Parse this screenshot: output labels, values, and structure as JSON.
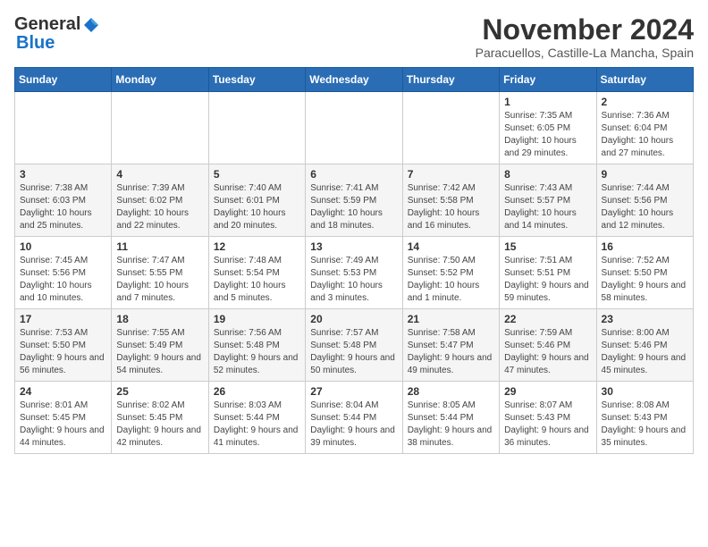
{
  "logo": {
    "general": "General",
    "blue": "Blue"
  },
  "title": "November 2024",
  "location": "Paracuellos, Castille-La Mancha, Spain",
  "headers": [
    "Sunday",
    "Monday",
    "Tuesday",
    "Wednesday",
    "Thursday",
    "Friday",
    "Saturday"
  ],
  "weeks": [
    [
      {
        "day": "",
        "info": ""
      },
      {
        "day": "",
        "info": ""
      },
      {
        "day": "",
        "info": ""
      },
      {
        "day": "",
        "info": ""
      },
      {
        "day": "",
        "info": ""
      },
      {
        "day": "1",
        "info": "Sunrise: 7:35 AM\nSunset: 6:05 PM\nDaylight: 10 hours and 29 minutes."
      },
      {
        "day": "2",
        "info": "Sunrise: 7:36 AM\nSunset: 6:04 PM\nDaylight: 10 hours and 27 minutes."
      }
    ],
    [
      {
        "day": "3",
        "info": "Sunrise: 7:38 AM\nSunset: 6:03 PM\nDaylight: 10 hours and 25 minutes."
      },
      {
        "day": "4",
        "info": "Sunrise: 7:39 AM\nSunset: 6:02 PM\nDaylight: 10 hours and 22 minutes."
      },
      {
        "day": "5",
        "info": "Sunrise: 7:40 AM\nSunset: 6:01 PM\nDaylight: 10 hours and 20 minutes."
      },
      {
        "day": "6",
        "info": "Sunrise: 7:41 AM\nSunset: 5:59 PM\nDaylight: 10 hours and 18 minutes."
      },
      {
        "day": "7",
        "info": "Sunrise: 7:42 AM\nSunset: 5:58 PM\nDaylight: 10 hours and 16 minutes."
      },
      {
        "day": "8",
        "info": "Sunrise: 7:43 AM\nSunset: 5:57 PM\nDaylight: 10 hours and 14 minutes."
      },
      {
        "day": "9",
        "info": "Sunrise: 7:44 AM\nSunset: 5:56 PM\nDaylight: 10 hours and 12 minutes."
      }
    ],
    [
      {
        "day": "10",
        "info": "Sunrise: 7:45 AM\nSunset: 5:56 PM\nDaylight: 10 hours and 10 minutes."
      },
      {
        "day": "11",
        "info": "Sunrise: 7:47 AM\nSunset: 5:55 PM\nDaylight: 10 hours and 7 minutes."
      },
      {
        "day": "12",
        "info": "Sunrise: 7:48 AM\nSunset: 5:54 PM\nDaylight: 10 hours and 5 minutes."
      },
      {
        "day": "13",
        "info": "Sunrise: 7:49 AM\nSunset: 5:53 PM\nDaylight: 10 hours and 3 minutes."
      },
      {
        "day": "14",
        "info": "Sunrise: 7:50 AM\nSunset: 5:52 PM\nDaylight: 10 hours and 1 minute."
      },
      {
        "day": "15",
        "info": "Sunrise: 7:51 AM\nSunset: 5:51 PM\nDaylight: 9 hours and 59 minutes."
      },
      {
        "day": "16",
        "info": "Sunrise: 7:52 AM\nSunset: 5:50 PM\nDaylight: 9 hours and 58 minutes."
      }
    ],
    [
      {
        "day": "17",
        "info": "Sunrise: 7:53 AM\nSunset: 5:50 PM\nDaylight: 9 hours and 56 minutes."
      },
      {
        "day": "18",
        "info": "Sunrise: 7:55 AM\nSunset: 5:49 PM\nDaylight: 9 hours and 54 minutes."
      },
      {
        "day": "19",
        "info": "Sunrise: 7:56 AM\nSunset: 5:48 PM\nDaylight: 9 hours and 52 minutes."
      },
      {
        "day": "20",
        "info": "Sunrise: 7:57 AM\nSunset: 5:48 PM\nDaylight: 9 hours and 50 minutes."
      },
      {
        "day": "21",
        "info": "Sunrise: 7:58 AM\nSunset: 5:47 PM\nDaylight: 9 hours and 49 minutes."
      },
      {
        "day": "22",
        "info": "Sunrise: 7:59 AM\nSunset: 5:46 PM\nDaylight: 9 hours and 47 minutes."
      },
      {
        "day": "23",
        "info": "Sunrise: 8:00 AM\nSunset: 5:46 PM\nDaylight: 9 hours and 45 minutes."
      }
    ],
    [
      {
        "day": "24",
        "info": "Sunrise: 8:01 AM\nSunset: 5:45 PM\nDaylight: 9 hours and 44 minutes."
      },
      {
        "day": "25",
        "info": "Sunrise: 8:02 AM\nSunset: 5:45 PM\nDaylight: 9 hours and 42 minutes."
      },
      {
        "day": "26",
        "info": "Sunrise: 8:03 AM\nSunset: 5:44 PM\nDaylight: 9 hours and 41 minutes."
      },
      {
        "day": "27",
        "info": "Sunrise: 8:04 AM\nSunset: 5:44 PM\nDaylight: 9 hours and 39 minutes."
      },
      {
        "day": "28",
        "info": "Sunrise: 8:05 AM\nSunset: 5:44 PM\nDaylight: 9 hours and 38 minutes."
      },
      {
        "day": "29",
        "info": "Sunrise: 8:07 AM\nSunset: 5:43 PM\nDaylight: 9 hours and 36 minutes."
      },
      {
        "day": "30",
        "info": "Sunrise: 8:08 AM\nSunset: 5:43 PM\nDaylight: 9 hours and 35 minutes."
      }
    ]
  ]
}
